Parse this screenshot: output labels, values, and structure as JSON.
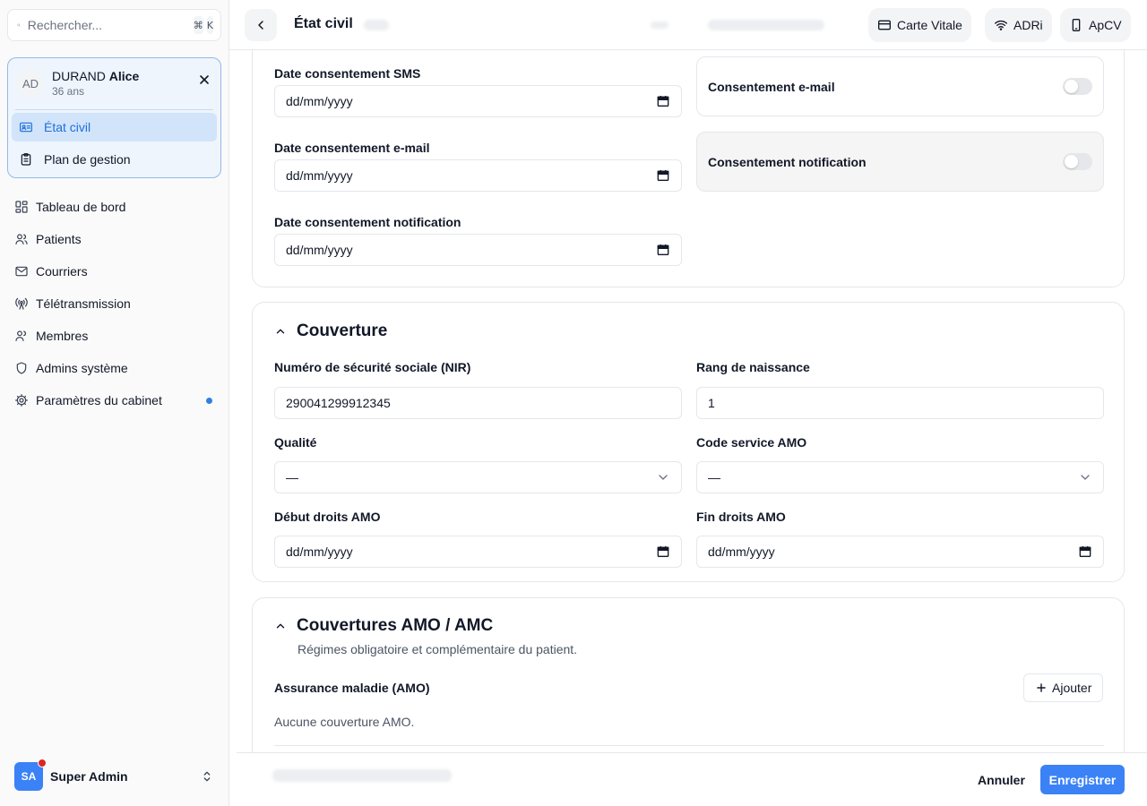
{
  "search": {
    "placeholder": "Rechercher...",
    "shortcut_mod": "⌘",
    "shortcut_key": "K"
  },
  "patient": {
    "initials": "AD",
    "last_name": "DURAND",
    "first_name": "Alice",
    "age": "36 ans",
    "nav": [
      {
        "label": "État civil",
        "active": true
      },
      {
        "label": "Plan de gestion",
        "active": false
      }
    ]
  },
  "sidebar": {
    "items": [
      {
        "label": "Tableau de bord",
        "icon": "dashboard-icon"
      },
      {
        "label": "Patients",
        "icon": "users-icon"
      },
      {
        "label": "Courriers",
        "icon": "mail-icon"
      },
      {
        "label": "Télétransmission",
        "icon": "antenna-icon"
      },
      {
        "label": "Membres",
        "icon": "user-icon"
      },
      {
        "label": "Admins système",
        "icon": "shield-icon"
      },
      {
        "label": "Paramètres du cabinet",
        "icon": "gear-icon",
        "dot": true
      }
    ],
    "user": {
      "initials": "SA",
      "name": "Super Admin"
    }
  },
  "header": {
    "title": "État civil",
    "actions": [
      {
        "label": "Carte Vitale",
        "icon": "card-icon"
      },
      {
        "label": "ADRi",
        "icon": "wifi-icon"
      },
      {
        "label": "ApCV",
        "icon": "phone-icon"
      }
    ]
  },
  "consent": {
    "date_sms_label": "Date consentement SMS",
    "date_sms_value": "dd/mm/yyyy",
    "date_email_label": "Date consentement e-mail",
    "date_email_value": "dd/mm/yyyy",
    "date_notif_label": "Date consentement notification",
    "date_notif_value": "dd/mm/yyyy",
    "toggle_email_label": "Consentement e-mail",
    "toggle_email_on": false,
    "toggle_notif_label": "Consentement notification",
    "toggle_notif_on": false
  },
  "couverture": {
    "title": "Couverture",
    "nir_label": "Numéro de sécurité sociale (NIR)",
    "nir_value": "290041299912345",
    "rang_label": "Rang de naissance",
    "rang_value": "1",
    "qualite_label": "Qualité",
    "qualite_value": "—",
    "code_amo_label": "Code service AMO",
    "code_amo_value": "—",
    "debut_label": "Début droits AMO",
    "debut_value": "dd/mm/yyyy",
    "fin_label": "Fin droits AMO",
    "fin_value": "dd/mm/yyyy"
  },
  "couvertures_amc": {
    "title": "Couvertures AMO / AMC",
    "subtitle": "Régimes obligatoire et complémentaire du patient.",
    "amo_label": "Assurance maladie (AMO)",
    "add_label": "Ajouter",
    "empty_amo": "Aucune couverture AMO."
  },
  "footer": {
    "cancel_label": "Annuler",
    "save_label": "Enregistrer"
  },
  "colors": {
    "accent": "#3b82f6",
    "active_bg": "#d2e4fa",
    "notification_dot": "#2f7fe6",
    "badge": "#dc2626"
  }
}
